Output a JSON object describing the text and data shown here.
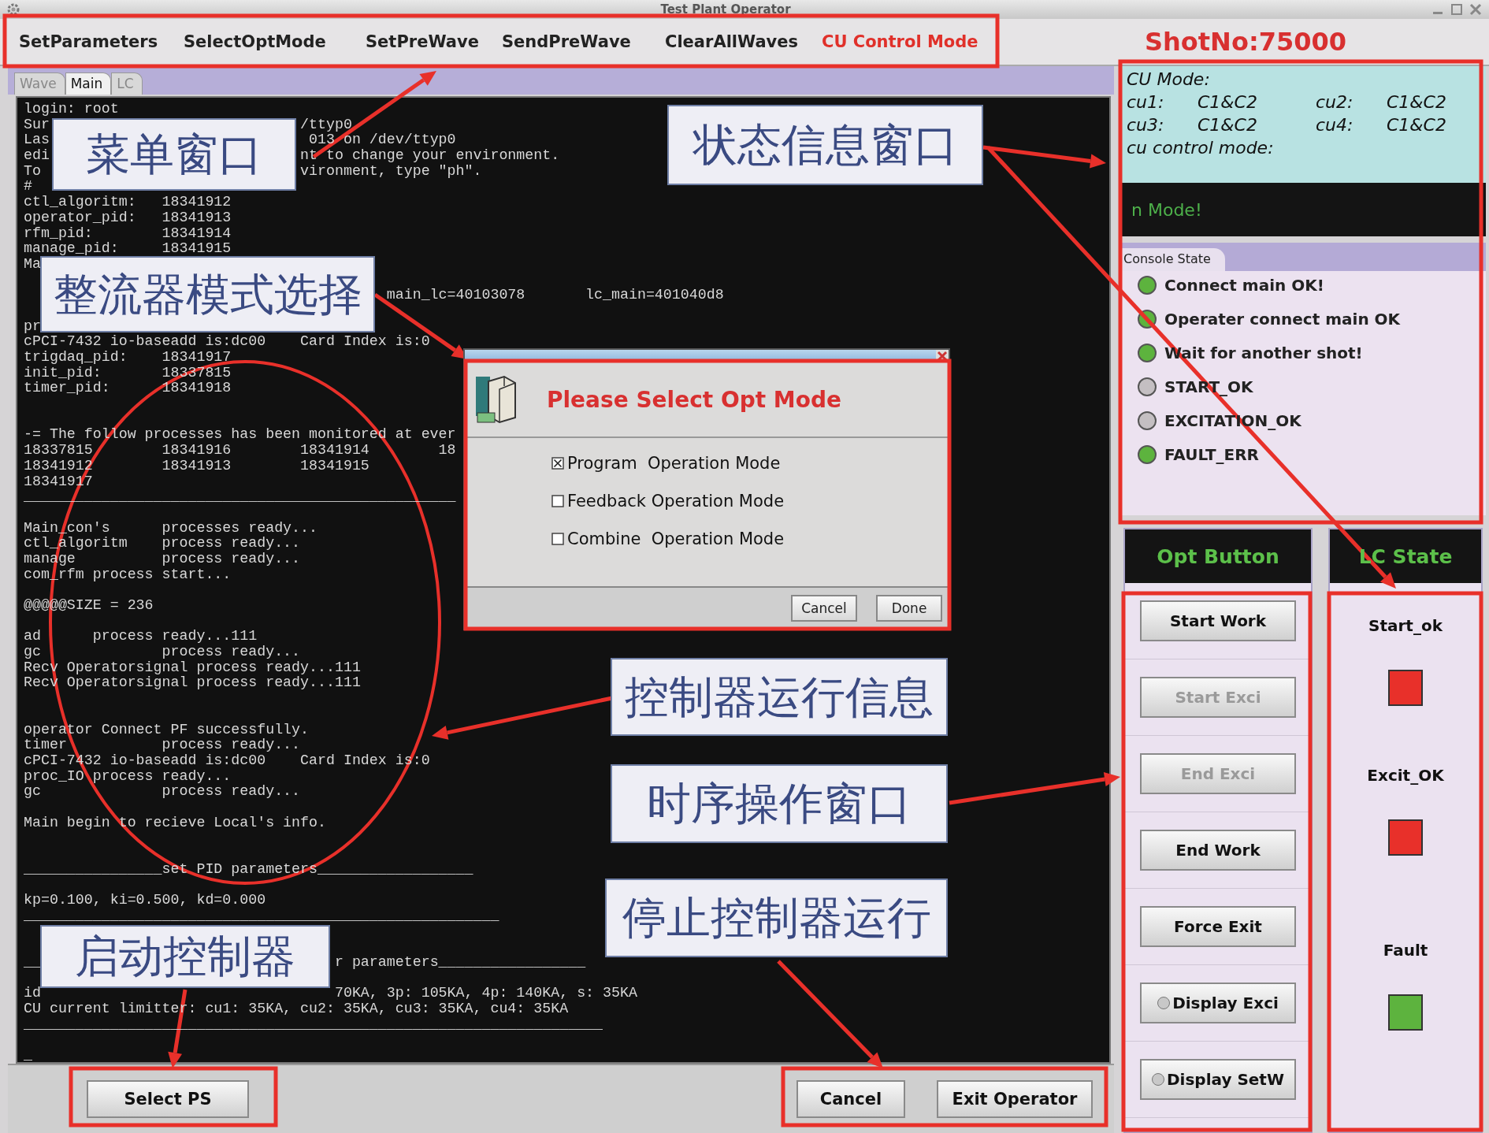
{
  "window": {
    "title": "Test Plant Operator"
  },
  "menu": [
    {
      "label": "SetParameters",
      "selected": false
    },
    {
      "label": "SelectOptMode",
      "selected": false
    },
    {
      "label": "SetPreWave",
      "selected": false
    },
    {
      "label": "SendPreWave",
      "selected": false
    },
    {
      "label": "ClearAllWaves",
      "selected": false
    },
    {
      "label": "CU Control Mode",
      "selected": true
    }
  ],
  "shot_number": "ShotNo:75000",
  "tabs": [
    {
      "label": "Wave",
      "selected": false
    },
    {
      "label": "Main",
      "selected": true
    },
    {
      "label": "LC",
      "selected": false
    }
  ],
  "terminal": {
    "blocks": [
      [
        "login: root",
        [
          "Sur",
          "                             /ttyp0"
        ],
        [
          "Las",
          "                              013 on /dev/ttyp0"
        ],
        [
          "edi",
          "                             nt to change your environment."
        ],
        [
          "To",
          "                              vironment, type \"ph\"."
        ],
        "#",
        "ctl_algoritm:   18341912",
        "operator_pid:   18341913",
        "rfm_pid:        18341914",
        "manage_pid:     18341915",
        "Ma"
      ],
      [
        [
          "                                          main_lc=40103078",
          "       lc_main=401040d8"
        ]
      ],
      [
        "pr",
        "cPCI-7432 io-baseadd is:dc00    Card Index is:0",
        "trigdaq_pid:    18341917",
        "init_pid:       18337815",
        "timer_pid:      18341918"
      ],
      [
        "-= The follow processes has been monitored at ever",
        "18337815        18341916        18341914        18",
        "18341912        18341913        18341915",
        "18341917",
        "__________________________________________________"
      ],
      [
        "Main_con's      processes ready...",
        "ctl_algoritm    process ready...",
        "manage          process ready...",
        "com_rfm process start..."
      ],
      [
        "@@@@@SIZE = 236"
      ],
      [
        "ad      process ready...111",
        "gc              process ready...",
        "Recv Operatorsignal process ready...111",
        "Recv Operatorsignal process ready...111"
      ],
      [
        "operator Connect PF successfully.",
        "timer           process ready...",
        "cPCI-7432 io-baseadd is:dc00    Card Index is:0",
        "proc_IO process ready...",
        "gc              process ready..."
      ],
      [
        "Main begin to recieve Local's info."
      ],
      [
        "________________set PID parameters__________________"
      ],
      [
        "kp=0.100, ki=0.500, kd=0.000",
        "_______________________________________________________"
      ],
      [
        [
          "__",
          "                                  r parameters_________________"
        ]
      ],
      [
        [
          "id",
          "                                  70KA, 3p: 105KA, 4p: 140KA, s: 35KA"
        ],
        "CU current limitter: cu1: 35KA, cu2: 35KA, cu3: 35KA, cu4: 35KA",
        "___________________________________________________________________"
      ],
      [
        "_"
      ]
    ]
  },
  "bottom_buttons": [
    {
      "label": "Select PS"
    },
    {
      "label": "Cancel"
    },
    {
      "label": "Exit Operator"
    }
  ],
  "cu_mode": {
    "title": "CU Mode:",
    "entries": [
      {
        "label": "cu1:",
        "value": "C1&C2"
      },
      {
        "label": "cu2:",
        "value": "C1&C2"
      },
      {
        "label": "cu3:",
        "value": "C1&C2"
      },
      {
        "label": "cu4:",
        "value": "C1&C2"
      }
    ],
    "control_label": "cu control mode:"
  },
  "mode_message": "n Mode!",
  "console_state": {
    "tab": "Console State",
    "items": [
      {
        "label": "Connect main OK!",
        "color": "#5db33e"
      },
      {
        "label": "Operater connect main OK",
        "color": "#5db33e"
      },
      {
        "label": "Wait for another shot!",
        "color": "#5db33e"
      },
      {
        "label": "START_OK",
        "color": "#c4bfc2"
      },
      {
        "label": "EXCITATION_OK",
        "color": "#c4bfc2"
      },
      {
        "label": "FAULT_ERR",
        "color": "#5db33e"
      }
    ]
  },
  "opt_button": {
    "title": "Opt Button",
    "buttons": [
      {
        "label": "Start Work",
        "kind": "push",
        "disabled": false
      },
      {
        "label": "Start Exci",
        "kind": "push",
        "disabled": true
      },
      {
        "label": "End Exci",
        "kind": "push",
        "disabled": true
      },
      {
        "label": "End Work",
        "kind": "push",
        "disabled": false
      },
      {
        "label": "Force Exit",
        "kind": "push",
        "disabled": false
      },
      {
        "label": "Display Exci",
        "kind": "radio",
        "selected": false,
        "disabled": false
      },
      {
        "label": "Display SetW",
        "kind": "radio",
        "selected": false,
        "disabled": false
      }
    ]
  },
  "lc_state": {
    "title": "LC State",
    "items": [
      {
        "label": "Start_ok",
        "color": "#e8302a"
      },
      {
        "label": "Excit_OK",
        "color": "#e8302a"
      },
      {
        "label": "Fault",
        "color": "#5db33e"
      }
    ]
  },
  "dialog": {
    "title": "Please Select Opt Mode",
    "options": [
      {
        "label": "Program  Operation Mode",
        "checked": true
      },
      {
        "label": "Feedback Operation Mode",
        "checked": false
      },
      {
        "label": "Combine  Operation Mode",
        "checked": false
      }
    ],
    "buttons": [
      {
        "label": "Cancel"
      },
      {
        "label": "Done"
      }
    ]
  },
  "annotations": [
    {
      "text": "菜单窗口"
    },
    {
      "text": "整流器模式选择"
    },
    {
      "text": "状态信息窗口"
    },
    {
      "text": "控制器运行信息"
    },
    {
      "text": "时序操作窗口"
    },
    {
      "text": "停止控制器运行"
    },
    {
      "text": "启动控制器"
    }
  ]
}
